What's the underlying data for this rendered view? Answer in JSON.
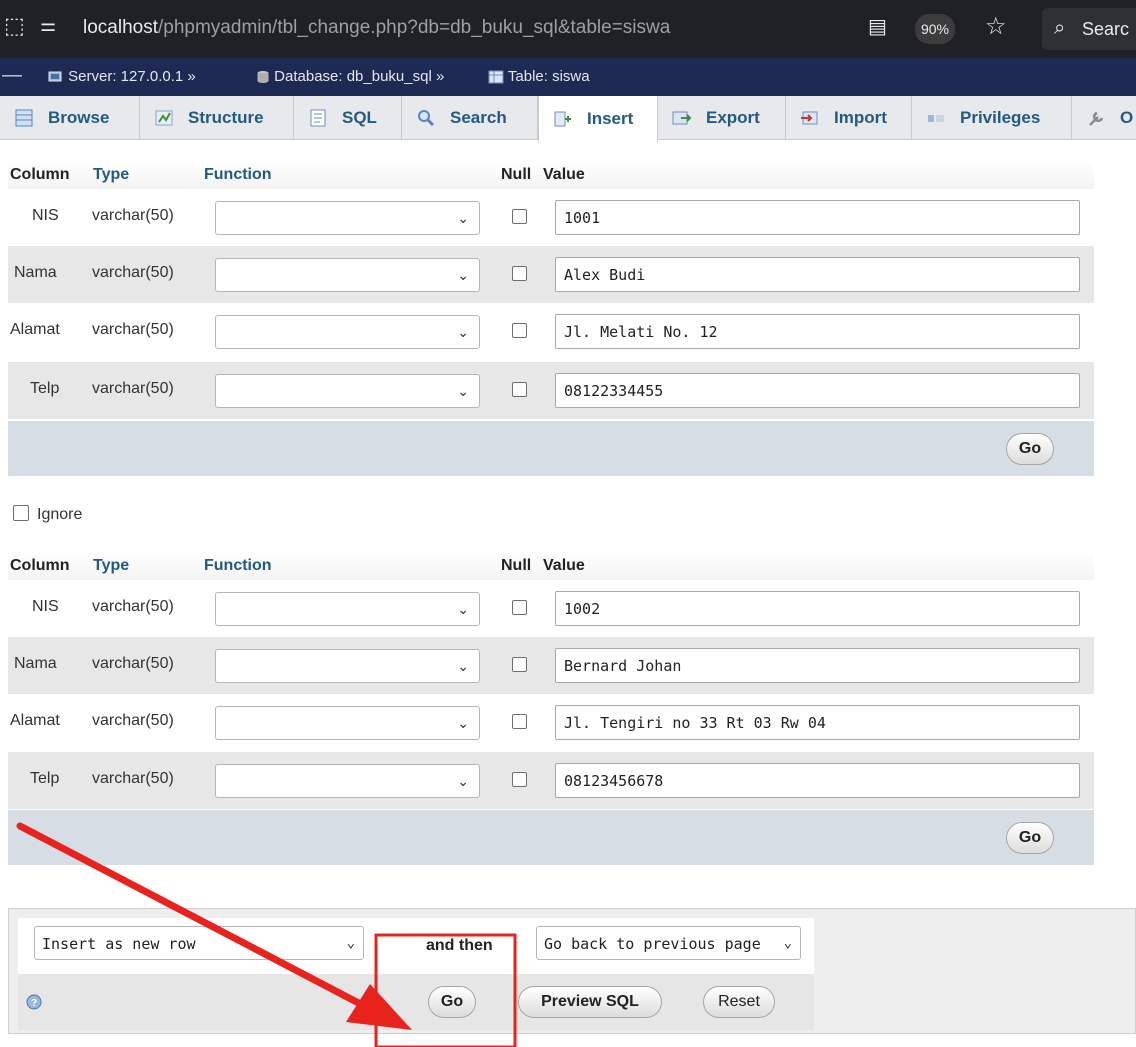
{
  "browser": {
    "url_host": "localhost",
    "url_path": "/phpmyadmin/tbl_change.php?db=db_buku_sql&table=siswa",
    "zoom": "90%",
    "search_label": "Searc"
  },
  "breadcrumb": {
    "server": "Server: 127.0.0.1 »",
    "database": "Database: db_buku_sql »",
    "table": "Table: siswa"
  },
  "tabs": [
    {
      "label": "Browse",
      "icon": "browse-icon"
    },
    {
      "label": "Structure",
      "icon": "structure-icon"
    },
    {
      "label": "SQL",
      "icon": "sql-icon"
    },
    {
      "label": "Search",
      "icon": "search-icon"
    },
    {
      "label": "Insert",
      "icon": "insert-icon",
      "active": true
    },
    {
      "label": "Export",
      "icon": "export-icon"
    },
    {
      "label": "Import",
      "icon": "import-icon"
    },
    {
      "label": "Privileges",
      "icon": "privileges-icon"
    },
    {
      "label": "O",
      "icon": "operations-icon"
    }
  ],
  "headers": {
    "column": "Column",
    "type": "Type",
    "function": "Function",
    "null": "Null",
    "value": "Value"
  },
  "form1": {
    "rows": [
      {
        "column": "NIS",
        "type": "varchar(50)",
        "value": "1001"
      },
      {
        "column": "Nama",
        "type": "varchar(50)",
        "value": "Alex Budi"
      },
      {
        "column": "Alamat",
        "type": "varchar(50)",
        "value": "Jl. Melati No. 12"
      },
      {
        "column": "Telp",
        "type": "varchar(50)",
        "value": "08122334455"
      }
    ],
    "go": "Go"
  },
  "ignore_label": "Ignore",
  "form2": {
    "rows": [
      {
        "column": "NIS",
        "type": "varchar(50)",
        "value": "1002"
      },
      {
        "column": "Nama",
        "type": "varchar(50)",
        "value": "Bernard Johan"
      },
      {
        "column": "Alamat",
        "type": "varchar(50)",
        "value": "Jl. Tengiri no 33 Rt 03 Rw 04"
      },
      {
        "column": "Telp",
        "type": "varchar(50)",
        "value": "08123456678"
      }
    ],
    "go": "Go"
  },
  "footer": {
    "insert_mode": "Insert as new row",
    "and_then": "and then",
    "after_action": "Go back to previous page",
    "go": "Go",
    "preview": "Preview SQL",
    "reset": "Reset"
  },
  "colors": {
    "tab_text": "#235a81",
    "annotation": "#e8231d",
    "navbar": "#1e2a54"
  }
}
